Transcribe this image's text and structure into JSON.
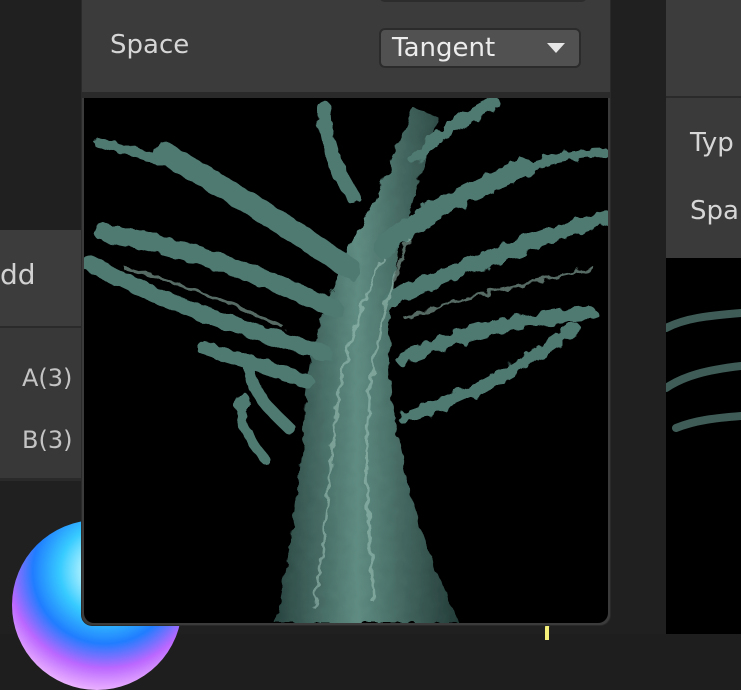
{
  "left_node": {
    "title": "dd",
    "ports": [
      "A(3)",
      "B(3)"
    ]
  },
  "center_node": {
    "space_label": "Space",
    "space_value": "Tangent",
    "preview_description": ""
  },
  "right_node": {
    "labels": [
      "Typ",
      "Spa"
    ]
  },
  "colors": {
    "node_bg": "#3b3b3b",
    "canvas_bg": "#202020",
    "dropdown_bg": "#515151",
    "text": "#d6d6d6"
  },
  "icons": {
    "dropdown": "chevron-down-icon"
  }
}
